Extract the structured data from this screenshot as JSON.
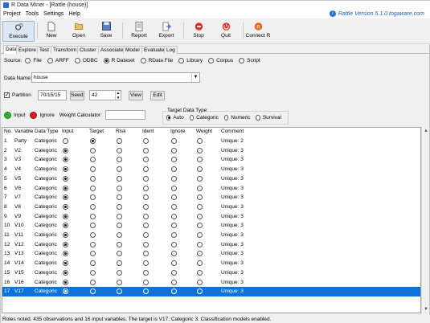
{
  "window": {
    "title": "R Data Miner - [Rattle (house)]"
  },
  "menu": [
    "Project",
    "Tools",
    "Settings",
    "Help"
  ],
  "version_link": "Rattle Version 5.1.0 togaware.com",
  "toolbar": [
    {
      "label": "Execute",
      "icon": "gears-icon"
    },
    {
      "label": "New",
      "icon": "new-icon"
    },
    {
      "label": "Open",
      "icon": "open-icon"
    },
    {
      "label": "Save",
      "icon": "save-icon"
    },
    {
      "label": "Report",
      "icon": "report-icon"
    },
    {
      "label": "Export",
      "icon": "export-icon"
    },
    {
      "label": "Stop",
      "icon": "stop-icon"
    },
    {
      "label": "Quit",
      "icon": "quit-icon"
    },
    {
      "label": "Connect R",
      "icon": "connect-r-icon"
    }
  ],
  "tabs": [
    "Data",
    "Explore",
    "Test",
    "Transform",
    "Cluster",
    "Associate",
    "Model",
    "Evaluate",
    "Log"
  ],
  "source": {
    "label": "Source:",
    "options": [
      "File",
      "ARFF",
      "ODBC",
      "R Dataset",
      "RData File",
      "Library",
      "Corpus",
      "Script"
    ],
    "selected": "R Dataset"
  },
  "data_name": {
    "label": "Data Name:",
    "value": "house"
  },
  "partition": {
    "label": "Partition",
    "checked": true,
    "value": "70/15/15",
    "seed_label": "Seed:",
    "seed": "42",
    "view": "View",
    "edit": "Edit"
  },
  "roles": {
    "input": "Input",
    "ignore": "Ignore",
    "weight_label": "Weight Calculator:"
  },
  "target_type": {
    "legend": "Target Data Type",
    "options": [
      "Auto",
      "Categoric",
      "Numeric",
      "Survival"
    ],
    "selected": "Auto"
  },
  "table": {
    "headers": [
      "No.",
      "Variable",
      "Data Type",
      "Input",
      "Target",
      "Risk",
      "Ident",
      "Ignore",
      "Weight",
      "Comment"
    ],
    "rows": [
      {
        "no": "1",
        "var": "Party",
        "type": "Categoric",
        "role": "target",
        "comment": "Unique: 2"
      },
      {
        "no": "2",
        "var": "V2",
        "type": "Categoric",
        "role": "input",
        "comment": "Unique: 3"
      },
      {
        "no": "3",
        "var": "V3",
        "type": "Categoric",
        "role": "input",
        "comment": "Unique: 3"
      },
      {
        "no": "4",
        "var": "V4",
        "type": "Categoric",
        "role": "input",
        "comment": "Unique: 3"
      },
      {
        "no": "5",
        "var": "V5",
        "type": "Categoric",
        "role": "input",
        "comment": "Unique: 3"
      },
      {
        "no": "6",
        "var": "V6",
        "type": "Categoric",
        "role": "input",
        "comment": "Unique: 3"
      },
      {
        "no": "7",
        "var": "V7",
        "type": "Categoric",
        "role": "input",
        "comment": "Unique: 3"
      },
      {
        "no": "8",
        "var": "V8",
        "type": "Categoric",
        "role": "input",
        "comment": "Unique: 3"
      },
      {
        "no": "9",
        "var": "V9",
        "type": "Categoric",
        "role": "input",
        "comment": "Unique: 3"
      },
      {
        "no": "10",
        "var": "V10",
        "type": "Categoric",
        "role": "input",
        "comment": "Unique: 3"
      },
      {
        "no": "11",
        "var": "V11",
        "type": "Categoric",
        "role": "input",
        "comment": "Unique: 3"
      },
      {
        "no": "12",
        "var": "V12",
        "type": "Categoric",
        "role": "input",
        "comment": "Unique: 3"
      },
      {
        "no": "13",
        "var": "V13",
        "type": "Categoric",
        "role": "input",
        "comment": "Unique: 3"
      },
      {
        "no": "14",
        "var": "V14",
        "type": "Categoric",
        "role": "input",
        "comment": "Unique: 3"
      },
      {
        "no": "15",
        "var": "V15",
        "type": "Categoric",
        "role": "input",
        "comment": "Unique: 3"
      },
      {
        "no": "16",
        "var": "V16",
        "type": "Categoric",
        "role": "input",
        "comment": "Unique: 3"
      },
      {
        "no": "17",
        "var": "V17",
        "type": "Categoric",
        "role": "input",
        "comment": "Unique: 3",
        "selected": true
      }
    ]
  },
  "status": "Roles noted. 435 observations and 16 input variables. The target is V17. Categoric 3. Classification models enabled.",
  "colors": {
    "selection": "#0b73d9",
    "input_dot": "#2fb52f",
    "ignore_dot": "#d42020",
    "link": "#1f5fbf"
  }
}
